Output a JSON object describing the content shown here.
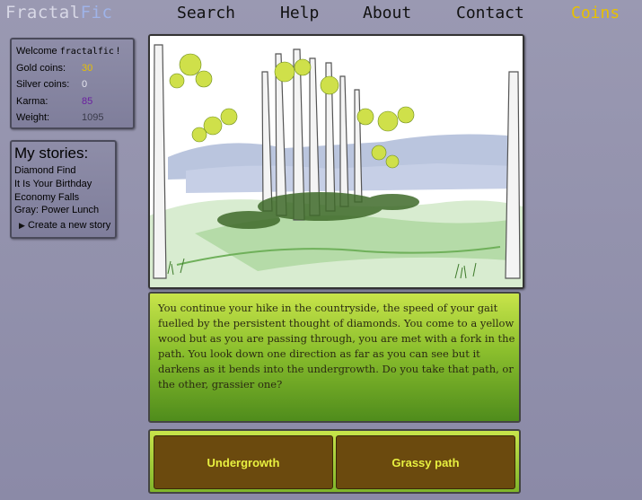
{
  "header": {
    "logo_part1": "Fractal",
    "logo_part2": "Fic",
    "nav": [
      "Search",
      "Help",
      "About",
      "Contact",
      "Coins"
    ]
  },
  "user": {
    "welcome_label": "Welcome",
    "username": "fractalfic",
    "welcome_suffix": "!",
    "stats": [
      {
        "label": "Gold coins:",
        "value": "30",
        "color": "#e8c000"
      },
      {
        "label": "Silver coins:",
        "value": "0",
        "color": "#e6e6f0"
      },
      {
        "label": "Karma:",
        "value": "85",
        "color": "#6a1fa0"
      },
      {
        "label": "Weight:",
        "value": "1095",
        "color": "#3a3a4a"
      }
    ]
  },
  "stories": {
    "title": "My stories:",
    "items": [
      "Diamond Find",
      "It Is Your Birthday",
      "Economy Falls",
      "Gray: Power Lunch"
    ],
    "create_label": "Create a new story"
  },
  "passage": {
    "text": "You continue your hike in the countryside, the speed of your gait fuelled by the persistent thought of diamonds.  You come to a yellow wood but as you are passing through, you are met with a fork in the path.  You look down one direction as far as you can see but it darkens as it bends into the undergrowth.  Do you take that path, or the other, grassier one?"
  },
  "choices": [
    "Undergrowth",
    "Grassy path"
  ],
  "colors": {
    "accent": "#e8c000",
    "choice_bg": "#6b4a0e",
    "choice_text": "#e8f040"
  }
}
